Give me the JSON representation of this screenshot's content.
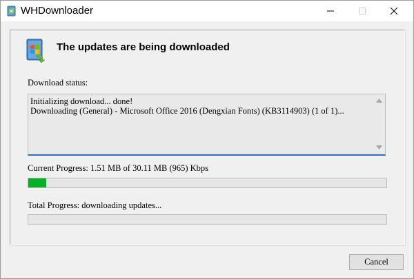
{
  "window": {
    "title": "WHDownloader",
    "icon": "whdownloader-app-icon",
    "buttons": [
      "minimize-icon",
      "maximize-icon",
      "close-icon"
    ]
  },
  "header": {
    "icon": "windows-update-icon",
    "title": "The updates are being downloaded"
  },
  "status": {
    "label": "Download status:",
    "lines": [
      "Initializing download... done!",
      "Downloading (General) - Microsoft Office 2016 (Dengxian Fonts) (KB3114903) (1 of 1)..."
    ]
  },
  "current_progress": {
    "label": "Current Progress: 1.51 MB of 30.11 MB (965) Kbps",
    "fraction": 0.0502,
    "bar_color": "#06b025"
  },
  "total_progress": {
    "label": "Total Progress: downloading updates...",
    "fraction": 0.0
  },
  "footer": {
    "cancel_label": "Cancel"
  }
}
